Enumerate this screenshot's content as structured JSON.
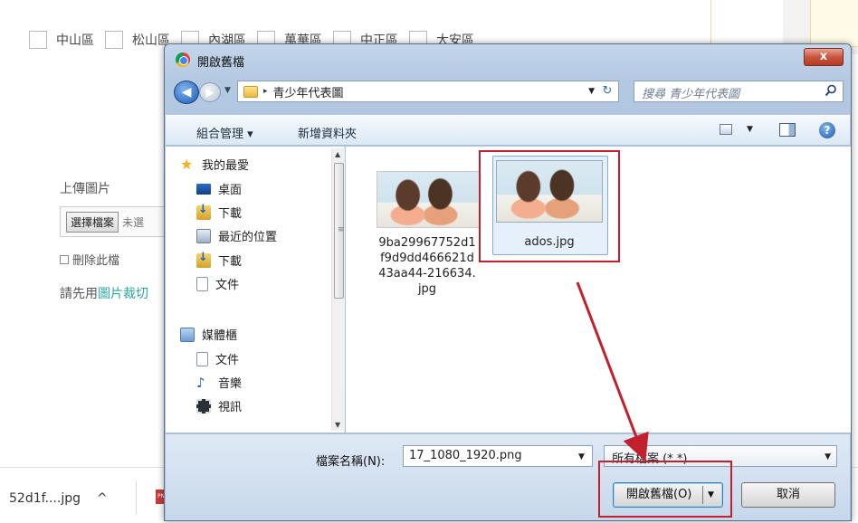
{
  "background": {
    "districts": [
      "中山區",
      "松山區",
      "內湖區",
      "萬華區",
      "中正區",
      "大安區"
    ],
    "upload_label": "上傳圖片",
    "choose_file_button": "選擇檔案",
    "no_file_text": "未選",
    "delete_label": "刪除此檔",
    "hint_prefix": "請先用",
    "hint_link": "圖片裁切",
    "download_bar": {
      "file_name": "52d1f....jpg",
      "chevron": "^"
    }
  },
  "dialog": {
    "title": "開啟舊檔",
    "close_label": "x",
    "address": {
      "path_sep": "▸",
      "folder": "青少年代表圖"
    },
    "search": {
      "placeholder": "搜尋 青少年代表圖"
    },
    "toolbar": {
      "organize": "組合管理 ▾",
      "new_folder": "新增資料夾"
    },
    "nav": {
      "items": [
        {
          "label": "我的最愛",
          "icon": "star-icon"
        },
        {
          "label": "桌面",
          "icon": "desktop-icon"
        },
        {
          "label": "下載",
          "icon": "downloads-icon"
        },
        {
          "label": "最近的位置",
          "icon": "recent-places-icon"
        },
        {
          "label": "下載",
          "icon": "downloads-icon"
        },
        {
          "label": "文件",
          "icon": "document-icon"
        },
        {
          "label": "媒體櫃",
          "icon": "library-icon"
        },
        {
          "label": "文件",
          "icon": "document-icon"
        },
        {
          "label": "音樂",
          "icon": "music-icon"
        },
        {
          "label": "視訊",
          "icon": "video-icon"
        }
      ]
    },
    "files": [
      {
        "name": "9ba29967752d1f9d9dd466621d43aa44-216634.jpg",
        "name_lines": [
          "9ba29967752d1",
          "f9d9dd466621d",
          "43aa44-216634.",
          "jpg"
        ]
      },
      {
        "name": "ados.jpg",
        "selected": true
      }
    ],
    "file_name_label": "檔案名稱(N):",
    "file_name_value": "17_1080_1920.png",
    "file_type_value": "所有檔案 (*.*)",
    "open_button": "開啟舊檔(O)",
    "cancel_button": "取消"
  },
  "colors": {
    "annotation_red": "#c2202d",
    "dialog_frame": "#b3c9e2",
    "link_teal": "#2aa7a0"
  }
}
